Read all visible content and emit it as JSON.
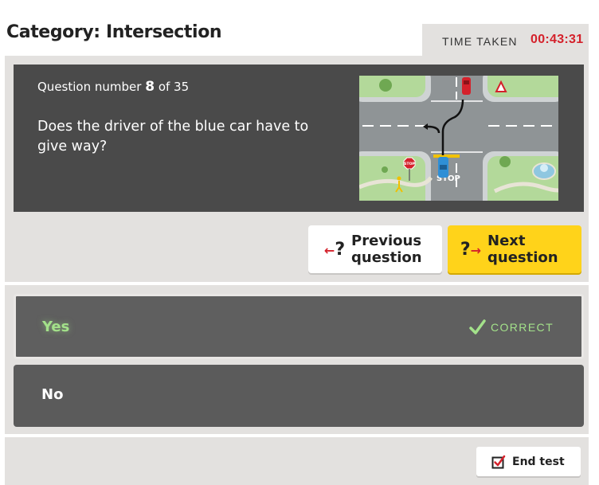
{
  "header": {
    "category_title": "Category: Intersection",
    "timer_label": "TIME TAKEN",
    "timer_value": "00:43:31"
  },
  "question": {
    "number_prefix": "Question number",
    "number": "8",
    "number_suffix": "of 35",
    "text": "Does the driver of the blue car have to give way?",
    "image_stop_sign_text": "STOP",
    "image_road_text": "STOP"
  },
  "nav": {
    "previous_label_line1": "Previous",
    "previous_label_line2": "question",
    "next_label_line1": "Next",
    "next_label_line2": "question",
    "previous_icon": "question-arrow-left-icon",
    "next_icon": "question-arrow-right-icon"
  },
  "answers": [
    {
      "label": "Yes",
      "status": "CORRECT",
      "selected": true
    },
    {
      "label": "No"
    }
  ],
  "footer": {
    "end_label": "End test",
    "end_icon": "checkbox-icon"
  },
  "colors": {
    "accent_red": "#d4212b",
    "next_yellow": "#ffd31a",
    "correct_green": "#a3e18a",
    "panel_dark": "#4a4a4a"
  }
}
